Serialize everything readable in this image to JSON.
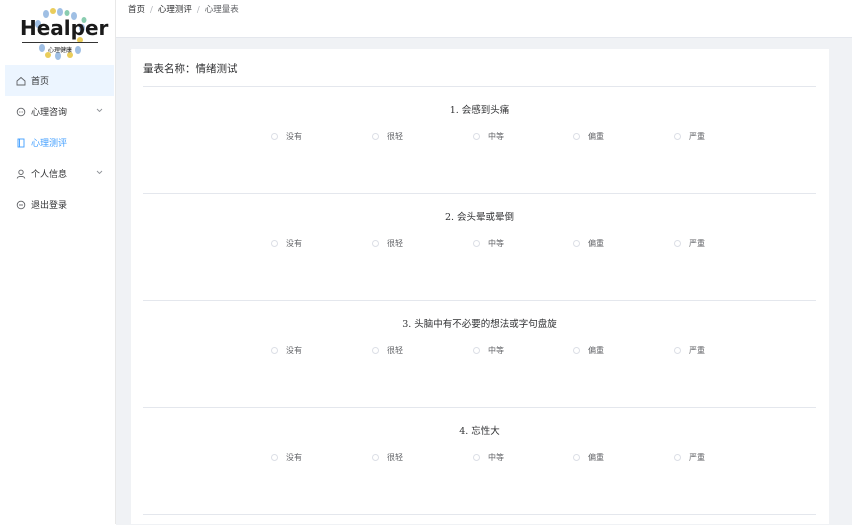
{
  "logo": {
    "brand": "Healper",
    "sub": "心理健康"
  },
  "sidebar": {
    "items": [
      {
        "label": "首页"
      },
      {
        "label": "心理咨询"
      },
      {
        "label": "心理测评"
      },
      {
        "label": "个人信息"
      },
      {
        "label": "退出登录"
      }
    ]
  },
  "breadcrumb": {
    "items": [
      "首页",
      "心理测评",
      "心理量表"
    ]
  },
  "scale": {
    "title": "量表名称：情绪测试"
  },
  "questions": [
    {
      "title": "1. 会感到头痛"
    },
    {
      "title": "2. 会头晕或晕倒"
    },
    {
      "title": "3. 头脑中有不必要的想法或字句盘旋"
    },
    {
      "title": "4. 忘性大"
    }
  ],
  "options": [
    "没有",
    "很轻",
    "中等",
    "偏重",
    "严重"
  ],
  "colors": {
    "accent": "#409eff",
    "active_bg": "#ecf5ff",
    "main_bg": "#f0f2f5"
  }
}
